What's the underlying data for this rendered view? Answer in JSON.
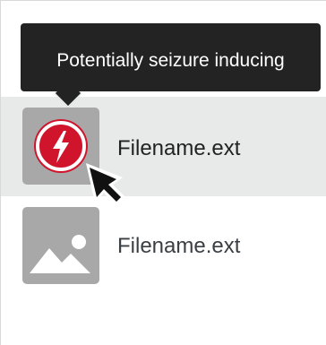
{
  "tooltip": {
    "text": "Potentially seizure inducing"
  },
  "files": [
    {
      "name": "Filename.ext",
      "thumbnail": "warning-flash-icon",
      "state": "hovered"
    },
    {
      "name": "Filename.ext",
      "thumbnail": "image-placeholder-icon",
      "state": "default"
    }
  ],
  "colors": {
    "hover_row_bg": "#e8eaea",
    "thumb_bg": "#a8a8a8",
    "warning_red": "#d0142c",
    "tooltip_bg": "#232323"
  },
  "cursor": "arrow-pointer-icon"
}
